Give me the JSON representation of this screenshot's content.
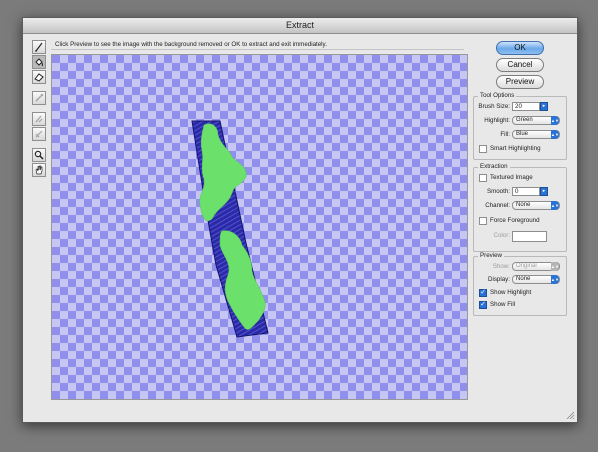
{
  "window": {
    "title": "Extract"
  },
  "hint_text": "Click Preview to see the image with the background removed or OK to extract and exit immediately.",
  "tools": [
    {
      "name": "edge-highlighter-tool",
      "icon": "marker-icon",
      "selected": false,
      "enabled": true
    },
    {
      "name": "fill-tool",
      "icon": "paint-bucket-icon",
      "selected": true,
      "enabled": true
    },
    {
      "name": "eraser-tool",
      "icon": "eraser-icon",
      "selected": false,
      "enabled": true
    },
    {
      "name": "eyedropper-tool",
      "icon": "eyedropper-icon",
      "selected": false,
      "enabled": false
    },
    {
      "name": "cleanup-tool",
      "icon": "cleanup-icon",
      "selected": false,
      "enabled": false
    },
    {
      "name": "edge-touchup-tool",
      "icon": "edge-touchup-icon",
      "selected": false,
      "enabled": false
    },
    {
      "name": "zoom-tool",
      "icon": "magnifier-icon",
      "selected": false,
      "enabled": true
    },
    {
      "name": "hand-tool",
      "icon": "hand-icon",
      "selected": false,
      "enabled": true
    }
  ],
  "buttons": {
    "ok": "OK",
    "cancel": "Cancel",
    "preview": "Preview"
  },
  "tool_options": {
    "title": "Tool Options",
    "brush_size_label": "Brush Size:",
    "brush_size_value": "20",
    "highlight_label": "Highlight:",
    "highlight_value": "Green",
    "fill_label": "Fill:",
    "fill_value": "Blue",
    "smart_highlighting_label": "Smart Highlighting",
    "smart_highlighting_checked": false
  },
  "extraction": {
    "title": "Extraction",
    "textured_image_label": "Textured Image",
    "textured_image_checked": false,
    "smooth_label": "Smooth:",
    "smooth_value": "0",
    "channel_label": "Channel:",
    "channel_value": "None",
    "force_foreground_label": "Force Foreground",
    "force_foreground_checked": false,
    "color_label": "Color:"
  },
  "preview": {
    "title": "Preview",
    "show_label": "Show:",
    "show_value": "Original",
    "display_label": "Display:",
    "display_value": "None",
    "show_highlight_label": "Show Highlight",
    "show_highlight_checked": true,
    "show_fill_label": "Show Fill",
    "show_fill_checked": true
  },
  "colors": {
    "canvas_dark": "#9090ec",
    "canvas_light": "#c6c6f4",
    "fill_blue": "#1c1c9c",
    "highlight_green": "#6be06b",
    "accent": "#2a73d6"
  }
}
